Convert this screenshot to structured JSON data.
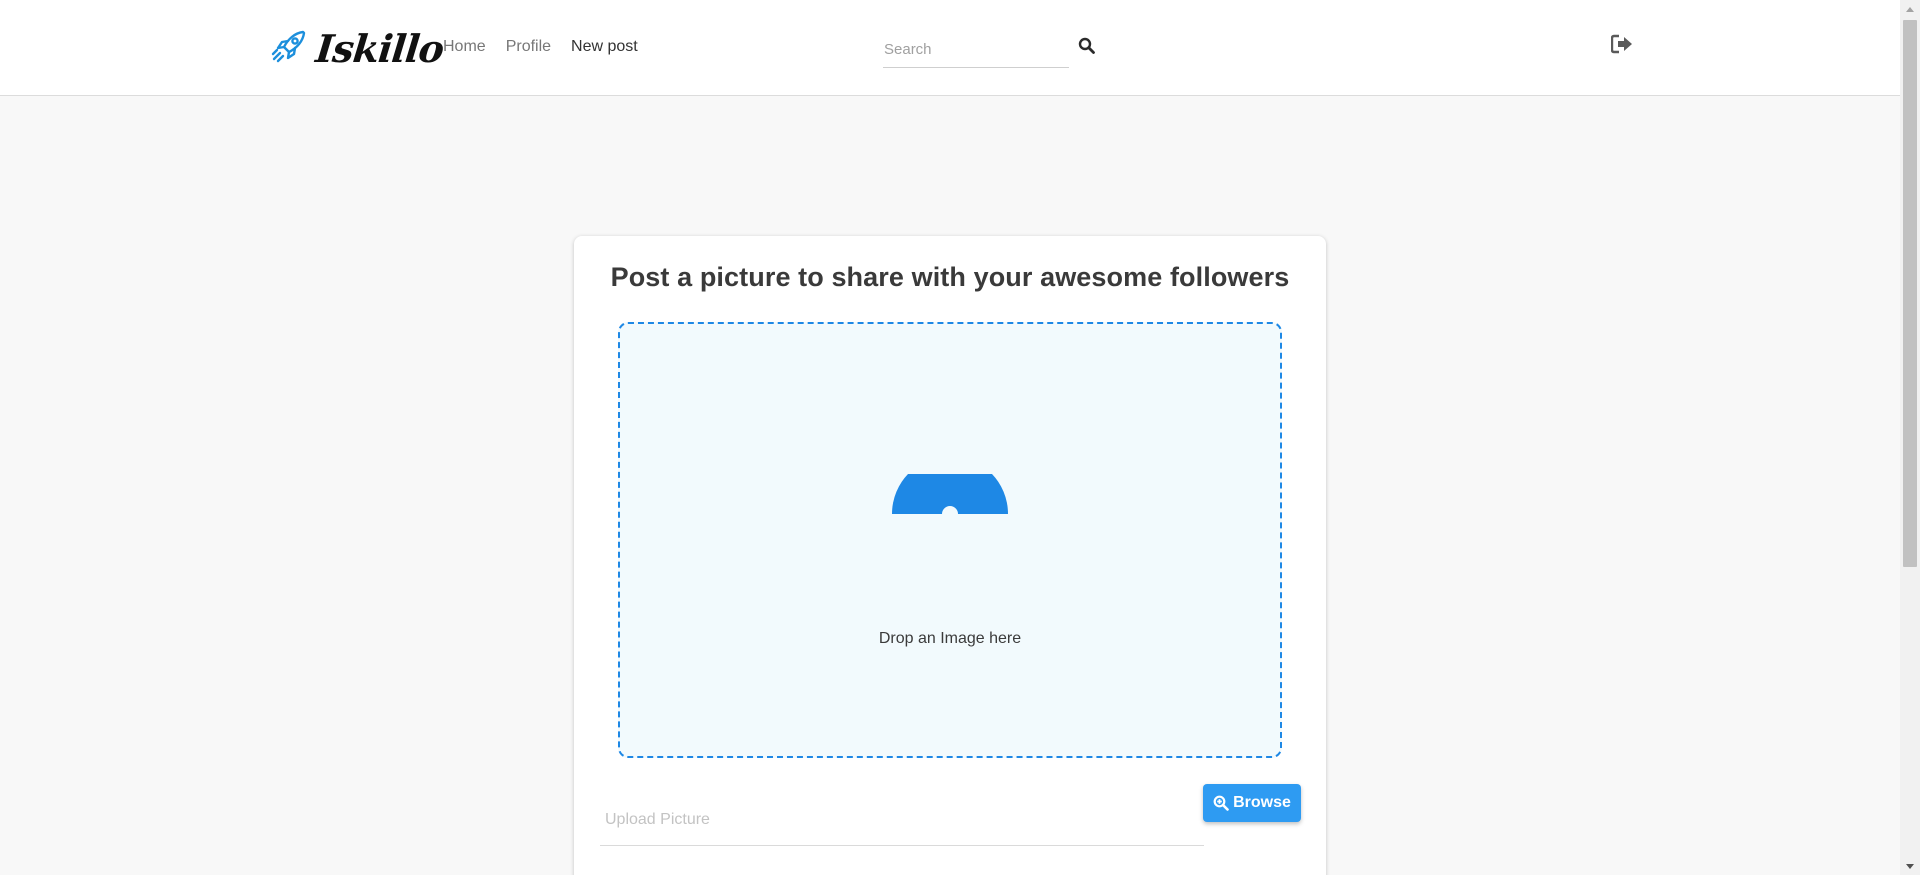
{
  "header": {
    "logo_text": "Iskillo",
    "logo_icon": "rocket-icon",
    "nav": [
      {
        "label": "Home"
      },
      {
        "label": "Profile"
      },
      {
        "label": "New post"
      }
    ],
    "search_placeholder": "Search",
    "search_icon": "search-icon",
    "logout_icon": "sign-out-icon"
  },
  "main": {
    "title": "Post a picture to share with your awesome followers",
    "dropzone_text": "Drop an Image here",
    "dropzone_icon": "upload-cloud-icon",
    "upload_placeholder": "Upload Picture",
    "browse_label": "Browse",
    "browse_icon": "search-plus-icon"
  },
  "colors": {
    "accent": "#1e88e5",
    "button": "#2e9bf2",
    "dropzone_bg": "#f2fafd",
    "page_bg": "#f8f8f8"
  }
}
